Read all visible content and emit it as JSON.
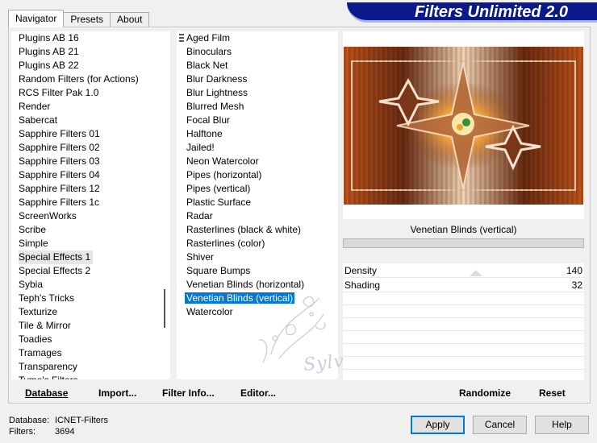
{
  "tabs": [
    "Navigator",
    "Presets",
    "About"
  ],
  "app_title": "Filters Unlimited 2.0",
  "categories": [
    "Plugins AB 16",
    "Plugins AB 21",
    "Plugins AB 22",
    "Random Filters (for Actions)",
    "RCS Filter Pak 1.0",
    "Render",
    "Sabercat",
    "Sapphire Filters 01",
    "Sapphire Filters 02",
    "Sapphire Filters 03",
    "Sapphire Filters 04",
    "Sapphire Filters 12",
    "Sapphire Filters 1c",
    "ScreenWorks",
    "Scribe",
    "Simple",
    "Special Effects 1",
    "Special Effects 2",
    "Sybia",
    "Teph's Tricks",
    "Texturize",
    "Tile & Mirror",
    "Toadies",
    "Tramages",
    "Transparency",
    "Tymo's Filters"
  ],
  "selected_category": "Special Effects 1",
  "filters": [
    "Aged Film",
    "Binoculars",
    "Black Net",
    "Blur Darkness",
    "Blur Lightness",
    "Blurred Mesh",
    "Focal Blur",
    "Halftone",
    "Jailed!",
    "Neon Watercolor",
    "Pipes (horizontal)",
    "Pipes (vertical)",
    "Plastic Surface",
    "Radar",
    "Rasterlines (black & white)",
    "Rasterlines (color)",
    "Shiver",
    "Square Bumps",
    "Venetian Blinds (horizontal)",
    "Venetian Blinds (vertical)",
    "Watercolor"
  ],
  "selected_filter": "Venetian Blinds (vertical)",
  "watermark": "Sylviane",
  "current_filter_name": "Venetian Blinds (vertical)",
  "params": [
    {
      "label": "Density",
      "value": "140"
    },
    {
      "label": "Shading",
      "value": "32"
    }
  ],
  "buttons": {
    "database": "Database",
    "import": "Import...",
    "filter_info": "Filter Info...",
    "editor": "Editor...",
    "randomize": "Randomize",
    "reset": "Reset",
    "apply": "Apply",
    "cancel": "Cancel",
    "help": "Help"
  },
  "status": {
    "database_label": "Database:",
    "database_value": "ICNET-Filters",
    "filters_label": "Filters:",
    "filters_value": "3694"
  },
  "colors": {
    "banner": "#0a1a8c",
    "selection": "#0078d7"
  }
}
